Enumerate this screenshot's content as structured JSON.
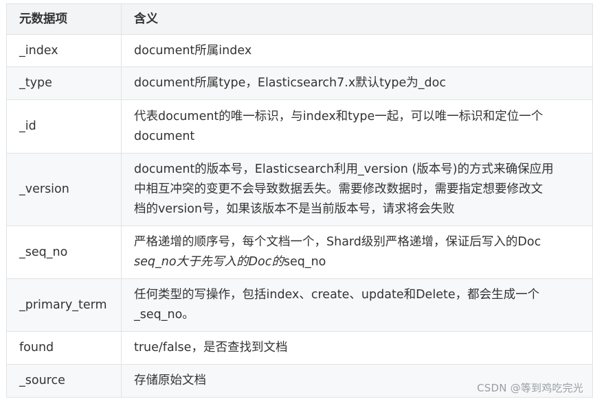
{
  "table": {
    "headers": [
      "元数据项",
      "含义"
    ],
    "rows": [
      {
        "field": "_index",
        "lines": [
          "document所属index"
        ]
      },
      {
        "field": "_type",
        "lines": [
          "document所属type，Elasticsearch7.x默认type为_doc"
        ]
      },
      {
        "field": "_id",
        "lines": [
          "代表document的唯一标识，与index和type一起，可以唯一标识和定位一个",
          "document"
        ]
      },
      {
        "field": "_version",
        "lines": [
          "document的版本号，Elasticsearch利用_version (版本号)的方式来确保应用",
          "中相互冲突的变更不会导致数据丢失。需要修改数据时，需要指定想要修改文",
          "档的version号，如果该版本不是当前版本号，请求将会失败"
        ]
      },
      {
        "field": "_seq_no",
        "lines": [
          "严格递增的顺序号，每个文档一个，Shard级别严格递增，保证后写入的Doc",
          "seq_no大于先写入的Doc的",
          "seq_no"
        ]
      },
      {
        "field": "_primary_term",
        "lines": [
          "任何类型的写操作，包括index、create、update和Delete，都会生成一个",
          "_seq_no。"
        ]
      },
      {
        "field": "found",
        "lines": [
          "true/false，是否查找到文档"
        ]
      },
      {
        "field": "_source",
        "lines": [
          "存储原始文档"
        ]
      }
    ]
  },
  "watermark": "CSDN @等到鸡吃完光"
}
